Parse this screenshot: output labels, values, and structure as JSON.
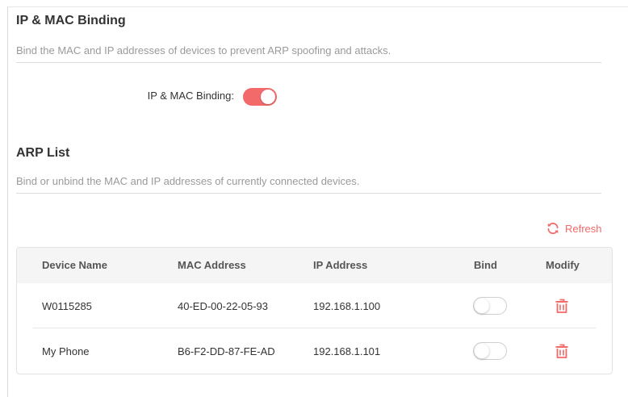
{
  "binding_section": {
    "title": "IP & MAC Binding",
    "description": "Bind the MAC and IP addresses of devices to prevent ARP spoofing and attacks.",
    "toggle_label": "IP & MAC Binding:",
    "toggle_on": true
  },
  "arp_section": {
    "title": "ARP List",
    "description": "Bind or unbind the MAC and IP addresses of currently connected devices.",
    "refresh_label": "Refresh"
  },
  "table": {
    "headers": {
      "device_name": "Device Name",
      "mac_address": "MAC Address",
      "ip_address": "IP Address",
      "bind": "Bind",
      "modify": "Modify"
    },
    "rows": [
      {
        "device_name": "W0115285",
        "mac_address": "40-ED-00-22-05-93",
        "ip_address": "192.168.1.100",
        "bind": false
      },
      {
        "device_name": "My Phone",
        "mac_address": "B6-F2-DD-87-FE-AD",
        "ip_address": "192.168.1.101",
        "bind": false
      }
    ]
  },
  "icons": {
    "refresh": "refresh-icon",
    "delete": "trash-icon"
  },
  "colors": {
    "accent": "#f26a6a",
    "text": "#333333",
    "muted": "#9a9a9a",
    "header_bg": "#f5f5f5"
  }
}
